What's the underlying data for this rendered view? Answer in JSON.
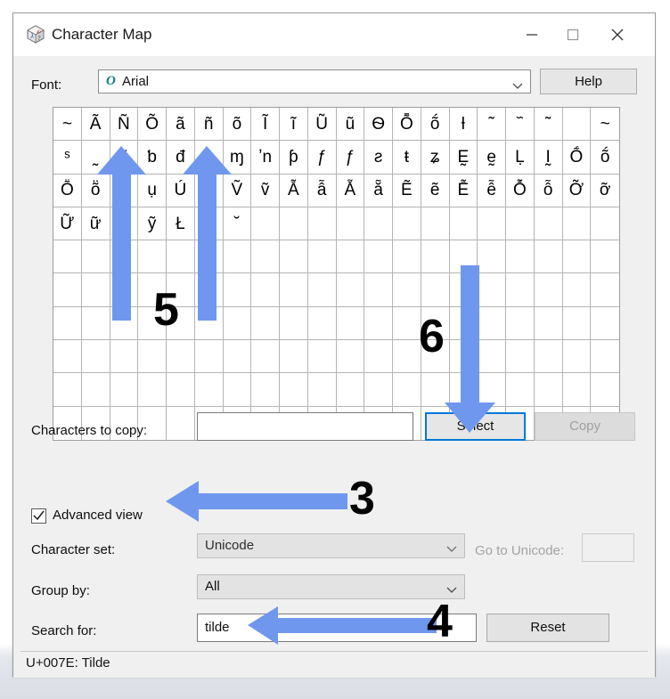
{
  "window": {
    "title": "Character Map",
    "icon": "character-map-icon",
    "caption_buttons": [
      {
        "name": "minimize-button",
        "glyph": "minimize-icon"
      },
      {
        "name": "maximize-button",
        "glyph": "maximize-icon"
      },
      {
        "name": "close-button",
        "glyph": "close-icon"
      }
    ]
  },
  "font_row": {
    "label": "Font:",
    "value": "Arial",
    "otf_marker": "O",
    "help_label": "Help"
  },
  "grid": {
    "columns": 20,
    "rows": 10,
    "cells": [
      "~",
      "Ã",
      "Ñ",
      "Õ",
      "ã",
      "ñ",
      "õ",
      "Ĩ",
      "ĩ",
      "Ũ",
      "ũ",
      "Ѳ",
      "Ȭ",
      "ṍ",
      "ƚ",
      "˜",
      "᷈",
      "˜",
      "",
      "~",
      "ˢ",
      "˷",
      "˜",
      "ƅ",
      "đ",
      "ƨ",
      "ɱ",
      "ʼn",
      "ƥ",
      "ƒ",
      "ƒ",
      "ƨ",
      "ŧ",
      "ʑ",
      "Ḛ",
      "ḛ",
      "Ḷ",
      "Ḭ",
      "Ṍ",
      "ṍ",
      "Ṏ",
      "ṏ",
      "Ụ",
      "ụ",
      "Ú",
      "",
      "Ṽ",
      "ṽ",
      "Ẫ",
      "ẫ",
      "Ẵ",
      "ẵ",
      "Ẽ",
      "ẽ",
      "Ễ",
      "ễ",
      "Ỗ",
      "ỗ",
      "Ỡ",
      "ỡ",
      "Ữ",
      "ữ",
      "Ỹ",
      "ỹ",
      "Ł",
      "",
      "˘",
      "",
      "",
      "",
      "",
      "",
      "",
      "",
      "",
      "",
      "",
      "",
      "",
      "",
      "",
      "",
      "",
      "",
      "",
      "",
      "",
      "",
      "",
      "",
      "",
      "",
      "",
      "",
      "",
      "",
      "",
      "",
      "",
      "",
      "",
      "",
      "",
      "",
      "",
      "",
      "",
      "",
      "",
      "",
      "",
      "",
      "",
      "",
      "",
      "",
      "",
      "",
      "",
      "",
      "",
      "",
      "",
      "",
      "",
      "",
      "",
      "",
      "",
      "",
      "",
      "",
      "",
      "",
      "",
      "",
      "",
      "",
      "",
      "",
      "",
      "",
      "",
      "",
      "",
      "",
      "",
      "",
      "",
      "",
      "",
      "",
      "",
      "",
      "",
      "",
      "",
      "",
      "",
      "",
      "",
      "",
      "",
      "",
      "",
      "",
      "",
      "",
      "",
      "",
      "",
      "",
      "",
      "",
      "",
      "",
      "",
      "",
      "",
      "",
      "",
      "",
      "",
      "",
      "",
      "",
      "",
      "",
      "",
      "",
      "",
      "",
      "",
      "",
      "",
      "",
      "",
      "",
      "",
      ""
    ]
  },
  "copy_row": {
    "label": "Characters to copy:",
    "input_value": "",
    "select_label": "Select",
    "copy_label": "Copy"
  },
  "advanced_view": {
    "label": "Advanced view",
    "checked": true
  },
  "charset_row": {
    "label": "Character set:",
    "value": "Unicode",
    "goto_label": "Go to Unicode:",
    "goto_value": ""
  },
  "group_row": {
    "label": "Group by:",
    "value": "All"
  },
  "search_row": {
    "label": "Search for:",
    "value": "tilde",
    "reset_label": "Reset"
  },
  "status": {
    "text": "U+007E: Tilde"
  },
  "annotations": {
    "arrow_color": "#6f97ee",
    "items": [
      {
        "number": "3",
        "direction": "left",
        "target": "advanced-view-checkbox"
      },
      {
        "number": "4",
        "direction": "left",
        "target": "search-input"
      },
      {
        "number": "5",
        "direction": "up",
        "target": "character-grid-tilde-cells"
      },
      {
        "number": "6",
        "direction": "down",
        "target": "select-button"
      }
    ]
  }
}
